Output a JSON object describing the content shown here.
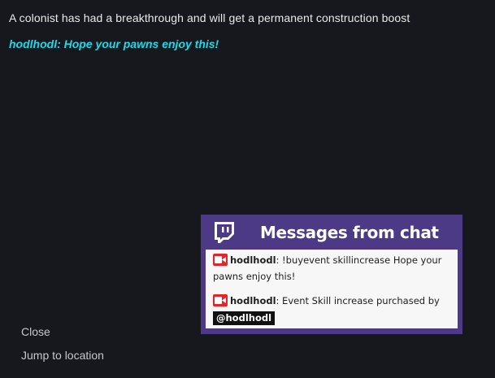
{
  "letter": {
    "text": "A colonist has had a breakthrough and will get a permanent construction boost",
    "viewer_line": "hodlhodl: Hope your pawns enjoy this!"
  },
  "options": {
    "close": "Close",
    "jump_to_location": "Jump to location"
  },
  "chat_overlay": {
    "title": "Messages from chat",
    "logo_icon": "twitch-logo-icon",
    "badge_icon": "camera-badge-icon",
    "messages": [
      {
        "username": "hodlhodl",
        "separator": ":",
        "text": " !buyevent skillincrease Hope your pawns enjoy this!"
      },
      {
        "username": "hodlhodl",
        "separator": ":",
        "text": " Event Skill increase purchased by ",
        "mention": "@hodlhodl"
      }
    ]
  },
  "colors": {
    "background": "#16181d",
    "viewer_line": "#21d8e6",
    "overlay_purple": "#4d3a87",
    "badge_red": "#e3242b"
  }
}
